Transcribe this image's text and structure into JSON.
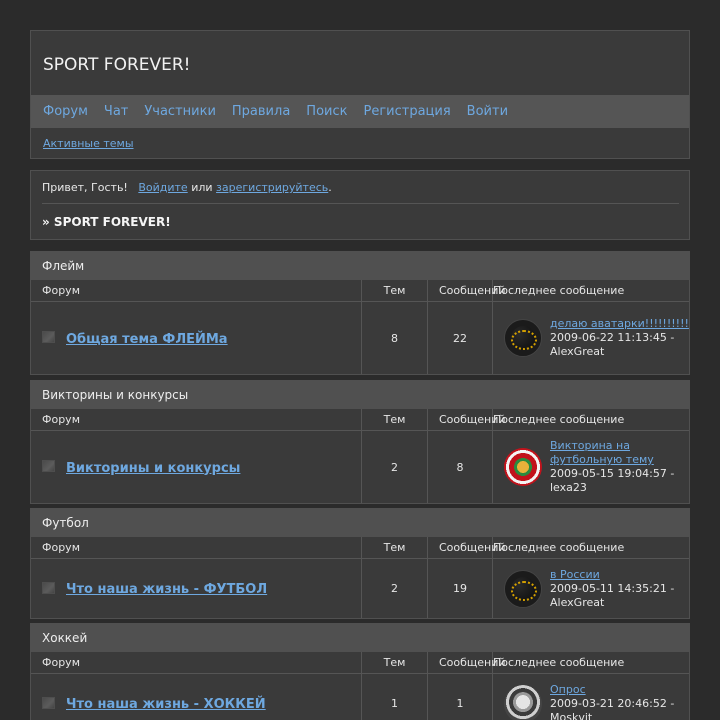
{
  "header": {
    "title": "SPORT FOREVER!",
    "menu": [
      "Форум",
      "Чат",
      "Участники",
      "Правила",
      "Поиск",
      "Регистрация",
      "Войти"
    ],
    "active_topics": "Активные темы"
  },
  "welcome": {
    "greeting": "Привет, Гость!",
    "login": "Войдите",
    "or": "или",
    "register": "зарегистрируйтесь",
    "dot": ".",
    "crumbs": "» SPORT FOREVER!"
  },
  "columns": {
    "forum": "Форум",
    "topics": "Тем",
    "posts": "Сообщений",
    "last": "Последнее сообщение"
  },
  "categories": [
    {
      "title": "Флейм",
      "forum": "Общая тема ФЛЕЙМа",
      "topics": "8",
      "posts": "22",
      "avatar": "avatar-icon",
      "last_link": "делаю аватарки!!!!!!!!!!",
      "last_meta": "2009-06-22 11:13:45 - AlexGreat"
    },
    {
      "title": "Викторины и конкурсы",
      "forum": "Викторины и конкурсы",
      "topics": "2",
      "posts": "8",
      "avatar": "avatar-icon",
      "last_link": "Викторина на футбольную тему",
      "last_meta": "2009-05-15 19:04:57 - lexa23"
    },
    {
      "title": "Футбол",
      "forum": "Что наша жизнь - ФУТБОЛ",
      "topics": "2",
      "posts": "19",
      "avatar": "avatar-icon",
      "last_link": "в России",
      "last_meta": "2009-05-11 14:35:21 - AlexGreat"
    },
    {
      "title": "Хоккей",
      "forum": "Что наша жизнь - ХОККЕЙ",
      "topics": "1",
      "posts": "1",
      "avatar": "avatar-icon",
      "last_link": "Опрос",
      "last_meta": "2009-03-21 20:46:52 - Moskvit"
    }
  ]
}
